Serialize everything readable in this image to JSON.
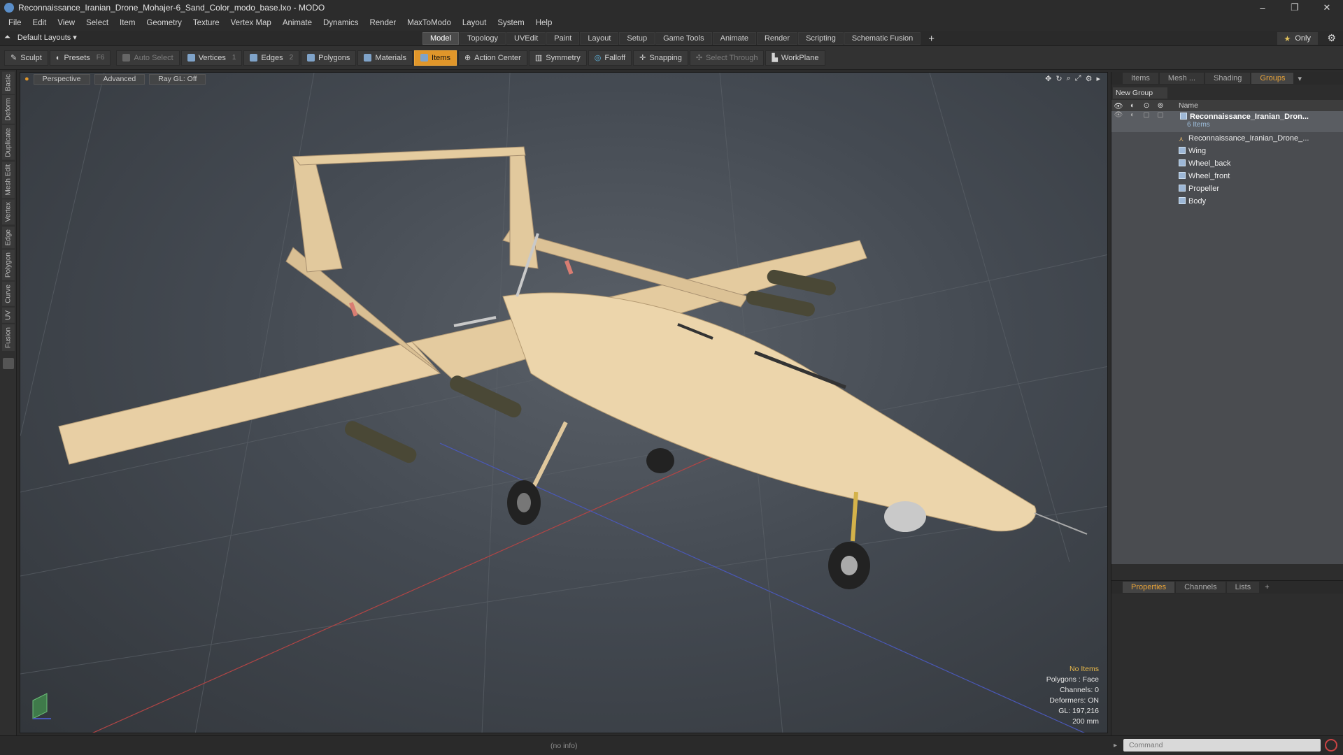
{
  "window": {
    "title": "Reconnaissance_Iranian_Drone_Mohajer-6_Sand_Color_modo_base.lxo - MODO",
    "controls": [
      "–",
      "❐",
      "✕"
    ]
  },
  "menu": [
    "File",
    "Edit",
    "View",
    "Select",
    "Item",
    "Geometry",
    "Texture",
    "Vertex Map",
    "Animate",
    "Dynamics",
    "Render",
    "MaxToModo",
    "Layout",
    "System",
    "Help"
  ],
  "layoutbar": {
    "layout_label": "Default Layouts ▾",
    "tabs": [
      "Model",
      "Topology",
      "UVEdit",
      "Paint",
      "Layout",
      "Setup",
      "Game Tools",
      "Animate",
      "Render",
      "Scripting",
      "Schematic Fusion"
    ],
    "active_tab": "Model",
    "plus": "+",
    "only_label": "Only"
  },
  "toolbar": {
    "sculpt": "Sculpt",
    "presets": "Presets",
    "presets_key": "F6",
    "auto_select": "Auto Select",
    "vertices": "Vertices",
    "vertices_count": "1",
    "edges": "Edges",
    "edges_count": "2",
    "polygons": "Polygons",
    "materials": "Materials",
    "items": "Items",
    "action_center": "Action Center",
    "symmetry": "Symmetry",
    "falloff": "Falloff",
    "snapping": "Snapping",
    "select_through": "Select Through",
    "workplane": "WorkPlane"
  },
  "left_tabs": [
    "Basic",
    "Deform",
    "Duplicate",
    "Mesh Edit",
    "Vertex",
    "Edge",
    "Polygon",
    "Curve",
    "UV",
    "Fusion"
  ],
  "viewport": {
    "view_mode": "Perspective",
    "shading": "Advanced",
    "raygl": "Ray GL: Off",
    "info": {
      "selection": "No Items",
      "polygons": "Polygons : Face",
      "channels": "Channels: 0",
      "deformers": "Deformers: ON",
      "gl": "GL: 197,216",
      "scale": "200 mm"
    }
  },
  "right_panel": {
    "tabs": [
      "Items",
      "Mesh ...",
      "Shading",
      "Groups"
    ],
    "active_tab": "Groups",
    "new_group": "New Group",
    "column_name": "Name",
    "group": {
      "name": "Reconnaissance_Iranian_Dron...",
      "count": "6 Items"
    },
    "items": [
      {
        "name": "Reconnaissance_Iranian_Drone_...",
        "icon": "locator-icon"
      },
      {
        "name": "Wing",
        "icon": "mesh-icon"
      },
      {
        "name": "Wheel_back",
        "icon": "mesh-icon"
      },
      {
        "name": "Wheel_front",
        "icon": "mesh-icon"
      },
      {
        "name": "Propeller",
        "icon": "mesh-icon"
      },
      {
        "name": "Body",
        "icon": "mesh-icon"
      }
    ]
  },
  "properties_panel": {
    "tabs": [
      "Properties",
      "Channels",
      "Lists"
    ],
    "active_tab": "Properties",
    "plus": "+"
  },
  "status": {
    "info": "(no info)",
    "command_placeholder": "Command"
  },
  "colors": {
    "accent": "#e0962a",
    "model_sand": "#e6cda2",
    "viewport_bg": "#444a52"
  }
}
